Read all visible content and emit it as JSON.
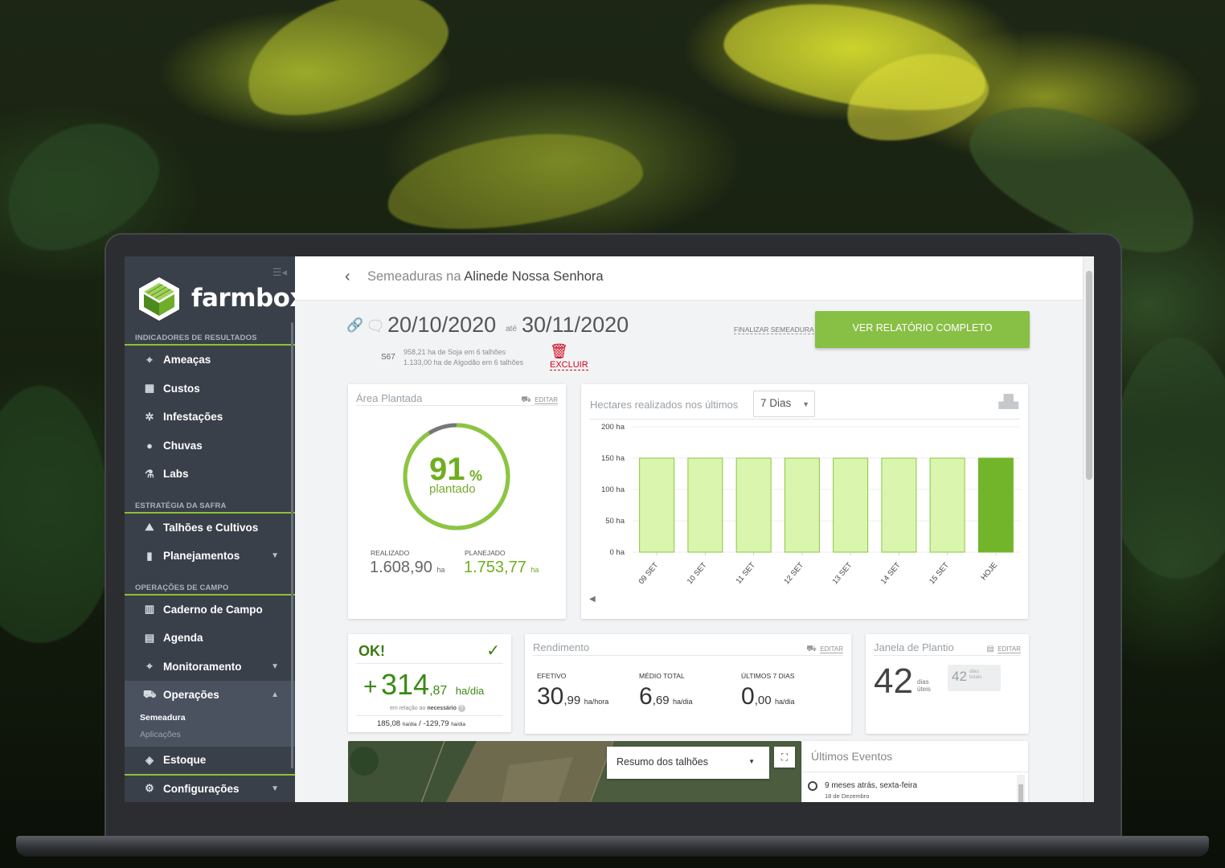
{
  "sidebar": {
    "brand": "farmbox",
    "sections": [
      {
        "title": "INDICADORES DE RESULTADOS"
      },
      {
        "title": "ESTRATÉGIA DA SAFRA"
      },
      {
        "title": "OPERAÇÕES DE CAMPO"
      }
    ],
    "items": {
      "ameacas": "Ameaças",
      "custos": "Custos",
      "infestacoes": "Infestações",
      "chuvas": "Chuvas",
      "labs": "Labs",
      "talhoes": "Talhões e Cultivos",
      "planejamentos": "Planejamentos",
      "caderno": "Caderno de Campo",
      "agenda": "Agenda",
      "monitoramento": "Monitoramento",
      "operacoes": "Operações",
      "semeadura": "Semeadura",
      "aplicacoes": "Aplicações",
      "estoque": "Estoque",
      "configuracoes": "Configurações"
    }
  },
  "header": {
    "crumb_prefix": "Semeaduras na",
    "crumb_farm": "Alinede Nossa Senhora"
  },
  "summary": {
    "date_start": "20/10/2020",
    "date_sep": "até",
    "date_end": "30/11/2020",
    "code": "S67",
    "line1": "958,21 ha de Soja em 6 talhões",
    "line2": "1.133,00 ha de Algodão em 6 talhões",
    "delete_label": "EXCLUIR",
    "finalize_label": "FINALIZAR SEMEADURA",
    "report_button": "VER RELATÓRIO COMPLETO"
  },
  "area_card": {
    "title": "Área Plantada",
    "edit": "EDITAR",
    "percent": "91",
    "percent_fraction": 0.91,
    "percent_sign": "%",
    "percent_label": "plantado",
    "realizado_label": "REALIZADO",
    "realizado_value": "1.608,90",
    "planejado_label": "PLANEJADO",
    "planejado_value": "1.753,77",
    "unit": "ha"
  },
  "chart_card": {
    "title": "Hectares realizados nos últimos",
    "period": "7 Dias"
  },
  "chart_data": {
    "type": "bar",
    "categories": [
      "09 SET",
      "10 SET",
      "11 SET",
      "12 SET",
      "13 SET",
      "14 SET",
      "15 SET",
      "HOJE"
    ],
    "values": [
      150,
      150,
      150,
      150,
      150,
      150,
      150,
      150
    ],
    "yticks": [
      "200 ha",
      "150 ha",
      "100 ha",
      "50 ha",
      "0 ha"
    ],
    "ylim": [
      0,
      200
    ],
    "colors": {
      "default": "#d9f5ae",
      "default_border": "#8cc63f",
      "highlight": "#72b52a"
    }
  },
  "ok_card": {
    "status": "OK!",
    "sign": "+",
    "value_int": "314",
    "value_dec": ",87",
    "unit": "ha/dia",
    "note_prefix": "em relação ao",
    "note_bold": "necessário",
    "footer_a": "185,08",
    "footer_unit": "ha/dia",
    "footer_sep": "/",
    "footer_b": "-129,79"
  },
  "rendimento": {
    "title": "Rendimento",
    "edit": "EDITAR",
    "cols": [
      {
        "label": "EFETIVO",
        "int": "30",
        "dec": ",99",
        "unit": "ha/hora"
      },
      {
        "label": "MÉDIO TOTAL",
        "int": "6",
        "dec": ",69",
        "unit": "ha/dia"
      },
      {
        "label": "ÚLTIMOS 7 DIAS",
        "int": "0",
        "dec": ",00",
        "unit": "ha/dia"
      }
    ]
  },
  "janela": {
    "title": "Janela de Plantio",
    "edit": "EDITAR",
    "days": "42",
    "days_l1": "dias",
    "days_l2": "úteis",
    "total": "42",
    "total_l1": "dias",
    "total_l2": "totais"
  },
  "map": {
    "select_label": "Resumo dos talhões"
  },
  "eventos": {
    "title": "Últimos Eventos",
    "item_title": "9 meses atrás, sexta-feira",
    "item_sub": "18 de Dezembro"
  }
}
